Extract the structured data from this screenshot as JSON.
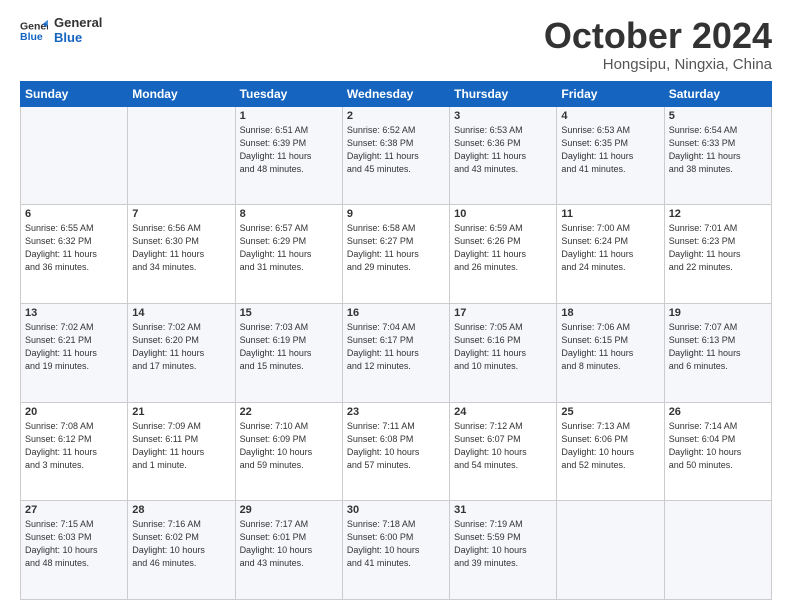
{
  "logo": {
    "line1": "General",
    "line2": "Blue"
  },
  "title": "October 2024",
  "subtitle": "Hongsipu, Ningxia, China",
  "weekdays": [
    "Sunday",
    "Monday",
    "Tuesday",
    "Wednesday",
    "Thursday",
    "Friday",
    "Saturday"
  ],
  "weeks": [
    [
      {
        "day": "",
        "info": ""
      },
      {
        "day": "",
        "info": ""
      },
      {
        "day": "1",
        "info": "Sunrise: 6:51 AM\nSunset: 6:39 PM\nDaylight: 11 hours\nand 48 minutes."
      },
      {
        "day": "2",
        "info": "Sunrise: 6:52 AM\nSunset: 6:38 PM\nDaylight: 11 hours\nand 45 minutes."
      },
      {
        "day": "3",
        "info": "Sunrise: 6:53 AM\nSunset: 6:36 PM\nDaylight: 11 hours\nand 43 minutes."
      },
      {
        "day": "4",
        "info": "Sunrise: 6:53 AM\nSunset: 6:35 PM\nDaylight: 11 hours\nand 41 minutes."
      },
      {
        "day": "5",
        "info": "Sunrise: 6:54 AM\nSunset: 6:33 PM\nDaylight: 11 hours\nand 38 minutes."
      }
    ],
    [
      {
        "day": "6",
        "info": "Sunrise: 6:55 AM\nSunset: 6:32 PM\nDaylight: 11 hours\nand 36 minutes."
      },
      {
        "day": "7",
        "info": "Sunrise: 6:56 AM\nSunset: 6:30 PM\nDaylight: 11 hours\nand 34 minutes."
      },
      {
        "day": "8",
        "info": "Sunrise: 6:57 AM\nSunset: 6:29 PM\nDaylight: 11 hours\nand 31 minutes."
      },
      {
        "day": "9",
        "info": "Sunrise: 6:58 AM\nSunset: 6:27 PM\nDaylight: 11 hours\nand 29 minutes."
      },
      {
        "day": "10",
        "info": "Sunrise: 6:59 AM\nSunset: 6:26 PM\nDaylight: 11 hours\nand 26 minutes."
      },
      {
        "day": "11",
        "info": "Sunrise: 7:00 AM\nSunset: 6:24 PM\nDaylight: 11 hours\nand 24 minutes."
      },
      {
        "day": "12",
        "info": "Sunrise: 7:01 AM\nSunset: 6:23 PM\nDaylight: 11 hours\nand 22 minutes."
      }
    ],
    [
      {
        "day": "13",
        "info": "Sunrise: 7:02 AM\nSunset: 6:21 PM\nDaylight: 11 hours\nand 19 minutes."
      },
      {
        "day": "14",
        "info": "Sunrise: 7:02 AM\nSunset: 6:20 PM\nDaylight: 11 hours\nand 17 minutes."
      },
      {
        "day": "15",
        "info": "Sunrise: 7:03 AM\nSunset: 6:19 PM\nDaylight: 11 hours\nand 15 minutes."
      },
      {
        "day": "16",
        "info": "Sunrise: 7:04 AM\nSunset: 6:17 PM\nDaylight: 11 hours\nand 12 minutes."
      },
      {
        "day": "17",
        "info": "Sunrise: 7:05 AM\nSunset: 6:16 PM\nDaylight: 11 hours\nand 10 minutes."
      },
      {
        "day": "18",
        "info": "Sunrise: 7:06 AM\nSunset: 6:15 PM\nDaylight: 11 hours\nand 8 minutes."
      },
      {
        "day": "19",
        "info": "Sunrise: 7:07 AM\nSunset: 6:13 PM\nDaylight: 11 hours\nand 6 minutes."
      }
    ],
    [
      {
        "day": "20",
        "info": "Sunrise: 7:08 AM\nSunset: 6:12 PM\nDaylight: 11 hours\nand 3 minutes."
      },
      {
        "day": "21",
        "info": "Sunrise: 7:09 AM\nSunset: 6:11 PM\nDaylight: 11 hours\nand 1 minute."
      },
      {
        "day": "22",
        "info": "Sunrise: 7:10 AM\nSunset: 6:09 PM\nDaylight: 10 hours\nand 59 minutes."
      },
      {
        "day": "23",
        "info": "Sunrise: 7:11 AM\nSunset: 6:08 PM\nDaylight: 10 hours\nand 57 minutes."
      },
      {
        "day": "24",
        "info": "Sunrise: 7:12 AM\nSunset: 6:07 PM\nDaylight: 10 hours\nand 54 minutes."
      },
      {
        "day": "25",
        "info": "Sunrise: 7:13 AM\nSunset: 6:06 PM\nDaylight: 10 hours\nand 52 minutes."
      },
      {
        "day": "26",
        "info": "Sunrise: 7:14 AM\nSunset: 6:04 PM\nDaylight: 10 hours\nand 50 minutes."
      }
    ],
    [
      {
        "day": "27",
        "info": "Sunrise: 7:15 AM\nSunset: 6:03 PM\nDaylight: 10 hours\nand 48 minutes."
      },
      {
        "day": "28",
        "info": "Sunrise: 7:16 AM\nSunset: 6:02 PM\nDaylight: 10 hours\nand 46 minutes."
      },
      {
        "day": "29",
        "info": "Sunrise: 7:17 AM\nSunset: 6:01 PM\nDaylight: 10 hours\nand 43 minutes."
      },
      {
        "day": "30",
        "info": "Sunrise: 7:18 AM\nSunset: 6:00 PM\nDaylight: 10 hours\nand 41 minutes."
      },
      {
        "day": "31",
        "info": "Sunrise: 7:19 AM\nSunset: 5:59 PM\nDaylight: 10 hours\nand 39 minutes."
      },
      {
        "day": "",
        "info": ""
      },
      {
        "day": "",
        "info": ""
      }
    ]
  ]
}
